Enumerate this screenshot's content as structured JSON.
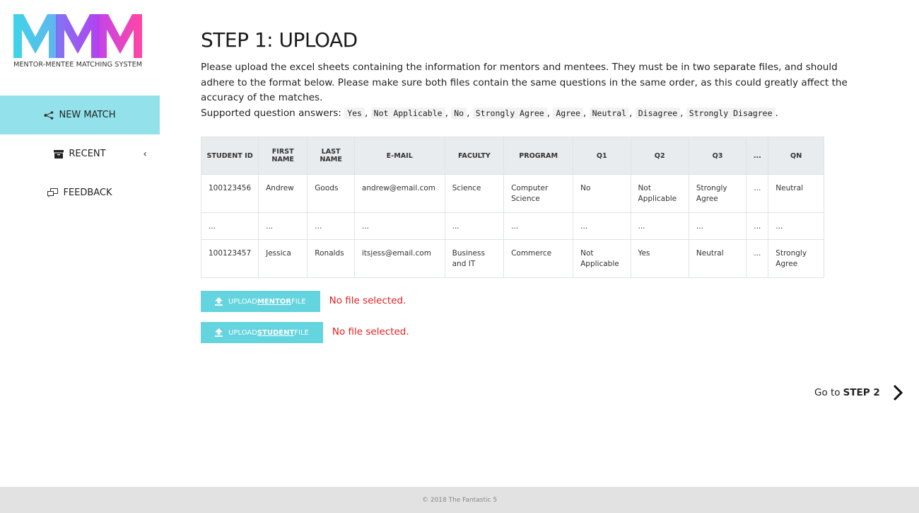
{
  "logo": {
    "letters": "MMM",
    "subtitle": "MENTOR-MENTEE MATCHING SYSTEM",
    "colors": [
      "#3fd4e6",
      "#a53cf0",
      "#ff3d9e"
    ]
  },
  "sidebar": {
    "items": [
      {
        "label": "NEW MATCH",
        "icon": "share-nodes-icon",
        "active": true
      },
      {
        "label": "RECENT",
        "icon": "archive-box-icon",
        "has_chevron": true
      },
      {
        "label": "FEEDBACK",
        "icon": "chat-bubbles-icon"
      }
    ]
  },
  "main": {
    "title": "STEP 1: UPLOAD",
    "description_line1": "Please upload the excel sheets containing the information for mentors and mentees. They must be in two separate files, and should adhere to the format below. Please make sure both files contain the same questions in the same order, as this could greatly affect the accuracy of the matches.",
    "supported_label": "Supported question answers:",
    "answers": [
      "Yes",
      "Not Applicable",
      "No",
      "Strongly Agree",
      "Agree",
      "Neutral",
      "Disagree",
      "Strongly Disagree"
    ]
  },
  "table": {
    "headers": [
      "STUDENT ID",
      "FIRST NAME",
      "LAST NAME",
      "E-MAIL",
      "FACULTY",
      "PROGRAM",
      "Q1",
      "Q2",
      "Q3",
      "...",
      "QN"
    ],
    "rows": [
      [
        "100123456",
        "Andrew",
        "Goods",
        "andrew@email.com",
        "Science",
        "Computer Science",
        "No",
        "Not Applicable",
        "Strongly Agree",
        "...",
        "Neutral"
      ],
      [
        "...",
        "...",
        "...",
        "...",
        "...",
        "...",
        "...",
        "...",
        "...",
        "...",
        "..."
      ],
      [
        "100123457",
        "Jessica",
        "Ronalds",
        "itsjess@email.com",
        "Business and IT",
        "Commerce",
        "Not Applicable",
        "Yes",
        "Neutral",
        "...",
        "Strongly Agree"
      ]
    ]
  },
  "uploads": {
    "mentor": {
      "prefix": "UPLOAD ",
      "strong": "MENTOR",
      "suffix": " FILE",
      "status": "No file selected."
    },
    "student": {
      "prefix": "UPLOAD ",
      "strong": "STUDENT",
      "suffix": " FILE",
      "status": "No file selected."
    }
  },
  "goto": {
    "prefix": "Go to",
    "step": "STEP 2"
  },
  "footer": {
    "text": "© 2018 The Fantastic 5"
  },
  "colors": {
    "accent": "#64d4df",
    "active_nav": "#93e1ea",
    "error": "#e41f1f",
    "footer_bg": "#e2e2e2"
  }
}
